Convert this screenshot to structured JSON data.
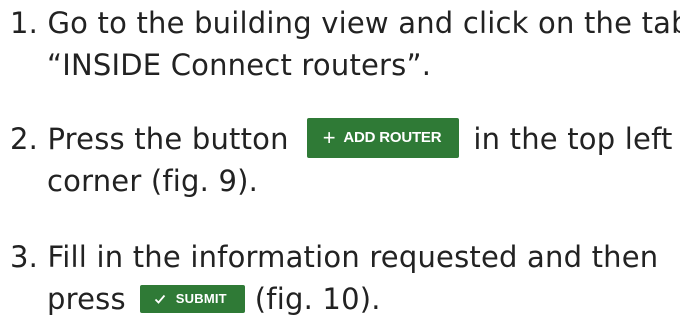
{
  "steps": [
    {
      "number": "1.",
      "line1": "Go to the building view and click on the tab",
      "line2": "“INSIDE Connect routers”."
    },
    {
      "number": "2.",
      "text_before": "Press the button",
      "text_after": "in the top left",
      "line2": "corner (fig. 9).",
      "button": {
        "label": "Add router",
        "icon": "plus-icon"
      }
    },
    {
      "number": "3.",
      "line1": "Fill in the information requested and then",
      "text_before": "press",
      "text_after": "(fig. 10).",
      "button": {
        "label": "Submit",
        "icon": "checkmark-icon"
      }
    }
  ],
  "colors": {
    "text": "#222222",
    "button_bg": "#2f7a36",
    "button_text": "#ffffff"
  }
}
